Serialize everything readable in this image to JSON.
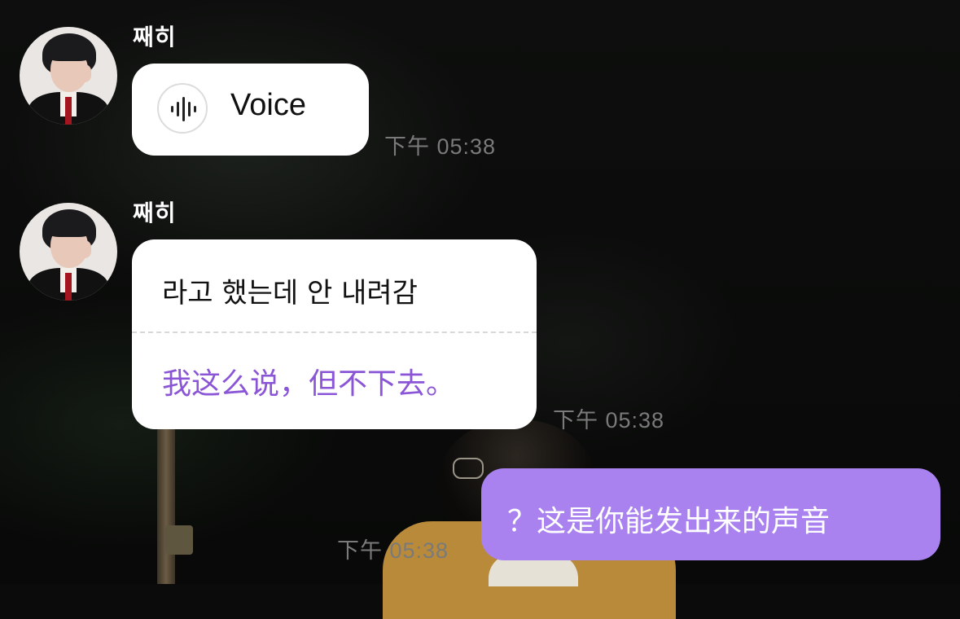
{
  "messages": [
    {
      "sender": "째히",
      "type": "voice",
      "voice_label": "Voice",
      "voice_icon": "voice-wave-icon",
      "time": "下午 05:38"
    },
    {
      "sender": "째히",
      "type": "text",
      "text": "라고 했는데 안 내려감",
      "translation": "我这么说，但不下去。",
      "time": "下午 05:38"
    },
    {
      "sender": "me",
      "type": "text",
      "text": "？这是你能发出来的声音",
      "time": "下午 05:38"
    }
  ],
  "colors": {
    "accent_purple": "#a982f0",
    "translation_purple": "#8a55d6",
    "bubble_white": "#ffffff",
    "timestamp_gray": "#7a7a7a"
  }
}
